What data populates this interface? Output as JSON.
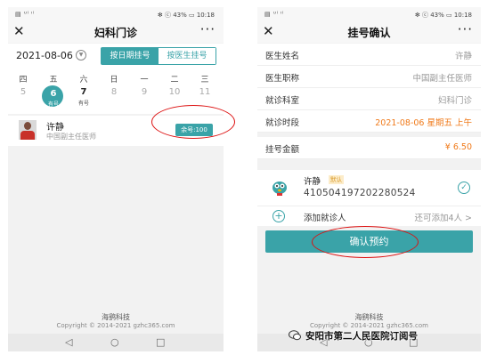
{
  "left": {
    "status": {
      "signal": "▤ ᵁˡ ᴵˡ",
      "right": "✻ ⓒ 43% ▭ 10:18"
    },
    "title": "妇科门诊",
    "date": "2021-08-06",
    "seg_by_date": "按日期挂号",
    "seg_by_doctor": "按医生挂号",
    "weekdays": [
      "四",
      "五",
      "六",
      "日",
      "一",
      "二",
      "三"
    ],
    "days": [
      "5",
      "6",
      "7",
      "8",
      "9",
      "10",
      "11"
    ],
    "day_status": [
      "有号",
      "有号"
    ],
    "doctor_name": "许静",
    "doctor_title": "中国副主任医师",
    "remaining": "余号:100",
    "footer_brand": "海鹞科技",
    "footer_copy": "Copyright © 2014-2021 gzhc365.com",
    "nav": {
      "back": "◁",
      "home": "○",
      "recent": "□"
    }
  },
  "right": {
    "status": {
      "signal": "▤ ᵁˡ ᴵˡ",
      "right": "✻ ⓒ 43% ▭ 10:18"
    },
    "title": "挂号确认",
    "rows": [
      {
        "k": "医生姓名",
        "v": "许静"
      },
      {
        "k": "医生职称",
        "v": "中国副主任医师"
      },
      {
        "k": "就诊科室",
        "v": "妇科门诊"
      },
      {
        "k": "就诊时段",
        "v": "2021-08-06 星期五 上午"
      }
    ],
    "fee_label": "挂号金额",
    "fee_value": "¥ 6.50",
    "patient_name": "许静",
    "patient_default": "默认",
    "patient_id": "410504197202280524",
    "add_label": "添加就诊人",
    "add_hint": "还可添加4人 >",
    "confirm": "确认预约",
    "footer_brand": "海鹞科技",
    "footer_copy": "Copyright © 2014-2021 gzhc365.com",
    "nav": {
      "back": "◁",
      "home": "○",
      "recent": "□"
    }
  },
  "watermark": "安阳市第二人民医院订阅号",
  "colors": {
    "teal": "#3aa3a8",
    "orange": "#f07a1a",
    "annotation_red": "#dd1111"
  }
}
